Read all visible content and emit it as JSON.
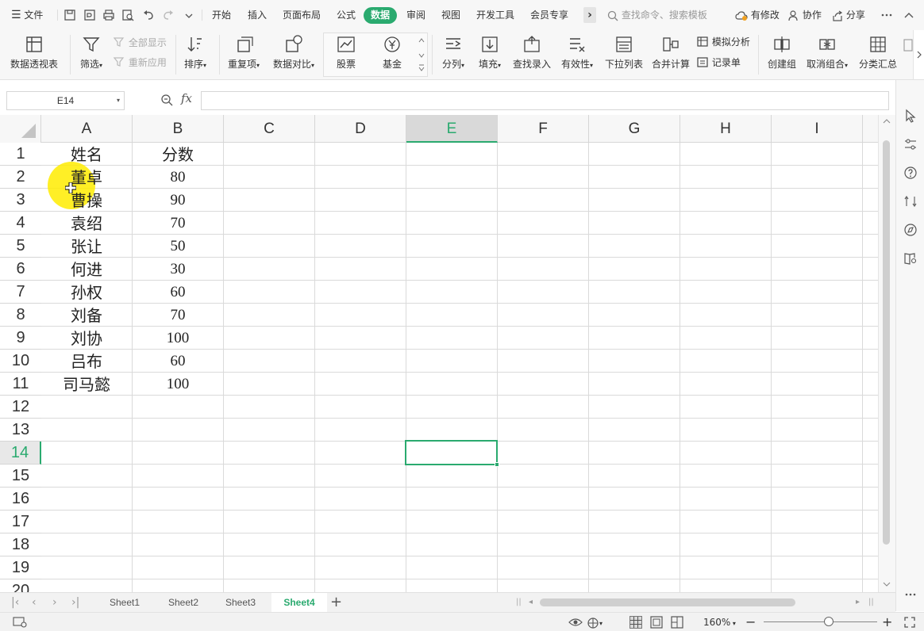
{
  "menu": {
    "file_label": "文件",
    "tabs": [
      "开始",
      "插入",
      "页面布局",
      "公式",
      "数据",
      "审阅",
      "视图",
      "开发工具",
      "会员专享"
    ],
    "active_tab": "数据",
    "more": "›",
    "search_placeholder": "查找命令、搜索模板",
    "has_changes": "有修改",
    "collaborate": "协作",
    "share": "分享"
  },
  "ribbon": {
    "pivot_table": "数据透视表",
    "filter": "筛选",
    "show_all": "全部显示",
    "reapply": "重新应用",
    "sort": "排序",
    "duplicates": "重复项",
    "compare": "数据对比",
    "stock": "股票",
    "fund": "基金",
    "split_column": "分列",
    "fill": "填充",
    "lookup_entry": "查找录入",
    "validity": "有效性",
    "dropdown_list": "下拉列表",
    "consolidate": "合并计算",
    "what_if": "模拟分析",
    "record_form": "记录单",
    "create_group": "创建组",
    "ungroup": "取消组合",
    "subtotal": "分类汇总"
  },
  "formula_bar": {
    "name_box": "E14",
    "fx": "fx",
    "value": ""
  },
  "sheet": {
    "columns": [
      "A",
      "B",
      "C",
      "D",
      "E",
      "F",
      "G",
      "H",
      "I"
    ],
    "selected_column": "E",
    "rows": [
      "1",
      "2",
      "3",
      "4",
      "5",
      "6",
      "7",
      "8",
      "9",
      "10",
      "11",
      "12",
      "13",
      "14",
      "15",
      "16",
      "17",
      "18",
      "19",
      "20"
    ],
    "selected_row": "14",
    "active_cell": "E14",
    "cells": {
      "A1": "姓名",
      "B1": "分数",
      "A2": "董卓",
      "B2": "80",
      "A3": "曹操",
      "B3": "90",
      "A4": "袁绍",
      "B4": "70",
      "A5": "张让",
      "B5": "50",
      "A6": "何进",
      "B6": "30",
      "A7": "孙权",
      "B7": "60",
      "A8": "刘备",
      "B8": "70",
      "A9": "刘协",
      "B9": "100",
      "A10": "吕布",
      "B10": "60",
      "A11": "司马懿",
      "B11": "100"
    }
  },
  "sheet_tabs": {
    "tabs": [
      "Sheet1",
      "Sheet2",
      "Sheet3",
      "Sheet4"
    ],
    "active": "Sheet4",
    "add": "+"
  },
  "status": {
    "zoom": "160%",
    "zoom_minus": "−",
    "zoom_plus": "+"
  },
  "colors": {
    "accent": "#2aaa6f",
    "cursor_highlight": "#ffec00"
  }
}
